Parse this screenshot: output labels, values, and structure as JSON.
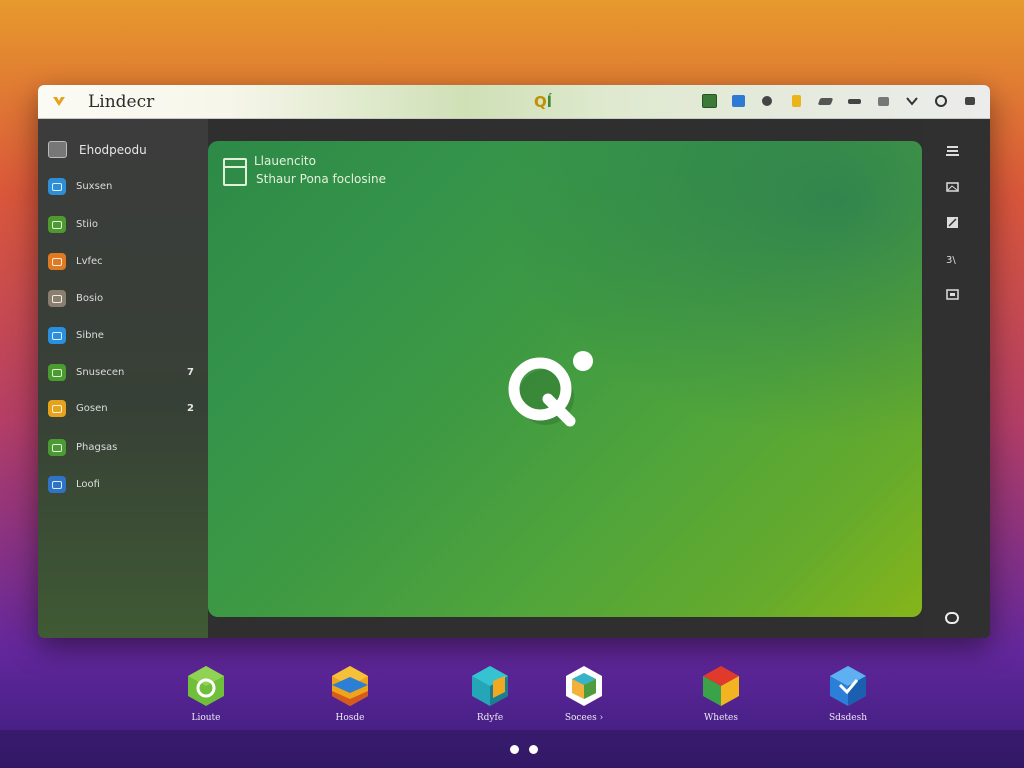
{
  "window": {
    "title": "Lindecr",
    "center_logo_a": "Q",
    "center_logo_b": "ĺ"
  },
  "toolbar": {
    "icons": [
      "green-square-icon",
      "blue-window-icon",
      "gear-icon",
      "yellow-note-icon",
      "brush-icon",
      "arrow-icon",
      "list-icon",
      "chevron-down-icon",
      "circle-icon",
      "tools-icon"
    ]
  },
  "sidebar": {
    "header": "Ehodpeodu",
    "items": [
      {
        "label": "Suxsen",
        "color": "#2f8fd6",
        "count": ""
      },
      {
        "label": "Stiio",
        "color": "#4e9a2f",
        "count": ""
      },
      {
        "label": "Lvfec",
        "color": "#e07a22",
        "count": ""
      },
      {
        "label": "Bosio",
        "color": "#8a7e6e",
        "count": ""
      },
      {
        "label": "Sibne",
        "color": "#2b8fe0",
        "count": ""
      },
      {
        "label": "Snusecen",
        "color": "#4a9c2e",
        "count": "7"
      },
      {
        "label": "Gosen",
        "color": "#e5a21c",
        "count": "2"
      },
      {
        "label": "Phagsas",
        "color": "#4c9a33",
        "count": ""
      },
      {
        "label": "Loofi",
        "color": "#2f73c9",
        "count": ""
      }
    ]
  },
  "main": {
    "title": "Llauencito",
    "subtitle": "Sthaur Pona foclosine"
  },
  "dock": [
    {
      "label": "Lioute",
      "name": "dock-app-lioute"
    },
    {
      "label": "Hosde",
      "name": "dock-app-hosde"
    },
    {
      "label": "Rdyfe",
      "name": "dock-app-rdyfe"
    },
    {
      "label": "Socees ›",
      "name": "dock-app-socees"
    },
    {
      "label": "Whetes",
      "name": "dock-app-whetes"
    },
    {
      "label": "Sdsdesh",
      "name": "dock-app-sdsdesh"
    }
  ]
}
